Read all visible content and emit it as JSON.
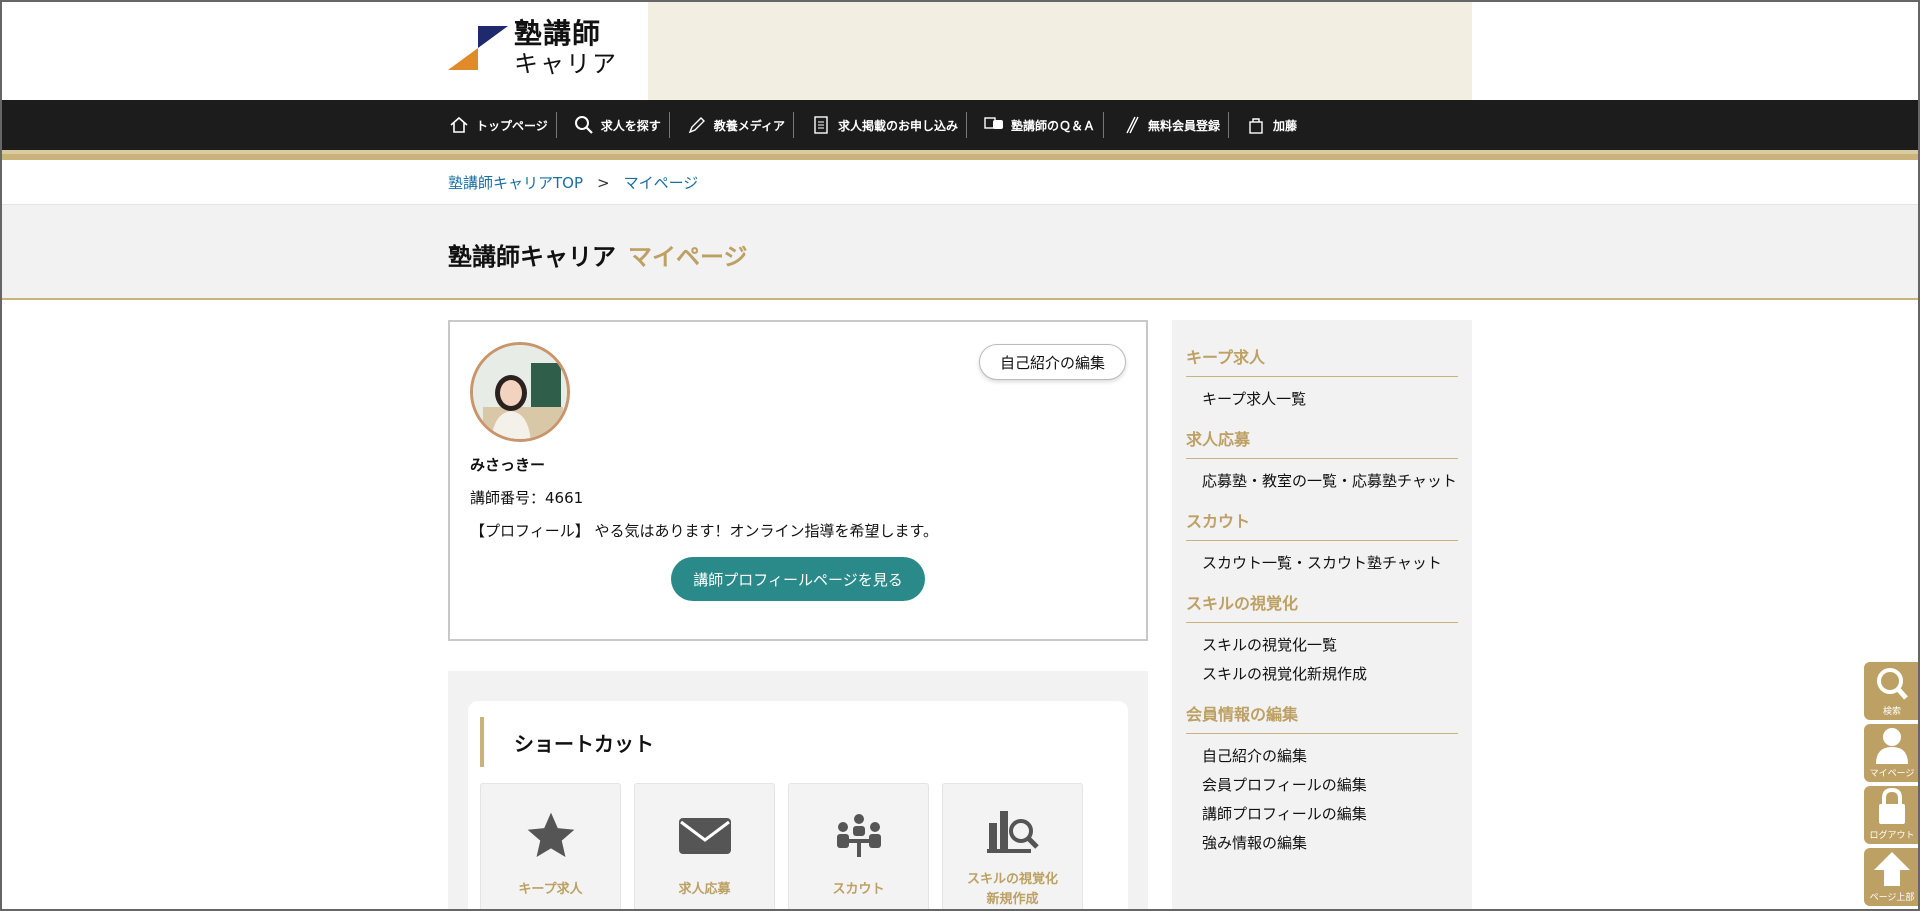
{
  "header": {
    "logo_line1": "塾講師",
    "logo_line2": "キャリア"
  },
  "nav": [
    {
      "label": "トップページ",
      "icon": "home-icon"
    },
    {
      "label": "求人を探す",
      "icon": "search-icon"
    },
    {
      "label": "教養メディア",
      "icon": "pen-icon"
    },
    {
      "label": "求人掲載のお申し込み",
      "icon": "document-icon"
    },
    {
      "label": "塾講師のＱ＆Ａ",
      "icon": "chat-icon"
    },
    {
      "label": "無料会員登録",
      "icon": "pencil-icon"
    },
    {
      "label": "加藤",
      "icon": "bag-icon"
    }
  ],
  "breadcrumb": {
    "home": "塾講師キャリアTOP",
    "sep": ">",
    "current": "マイページ"
  },
  "title": {
    "main": "塾講師キャリア",
    "accent": "マイページ"
  },
  "profile": {
    "edit_button": "自己紹介の編集",
    "name": "みさっきー",
    "id_text": "講師番号：4661",
    "profile_text": "【プロフィール】 やる気はあります！オンライン指導を希望します。",
    "view_button": "講師プロフィールページを見る"
  },
  "shortcut": {
    "heading": "ショートカット",
    "tiles": [
      {
        "label": "キープ求人",
        "icon": "star-icon"
      },
      {
        "label": "求人応募",
        "icon": "mail-icon"
      },
      {
        "label": "スカウト",
        "icon": "meeting-icon"
      },
      {
        "label": "スキルの視覚化\n新規作成",
        "icon": "chart-search-icon"
      }
    ]
  },
  "sidebar": {
    "sections": [
      {
        "heading": "キープ求人",
        "links": [
          "キープ求人一覧"
        ]
      },
      {
        "heading": "求人応募",
        "links": [
          "応募塾・教室の一覧・応募塾チャット"
        ]
      },
      {
        "heading": "スカウト",
        "links": [
          "スカウト一覧・スカウト塾チャット"
        ]
      },
      {
        "heading": "スキルの視覚化",
        "links": [
          "スキルの視覚化一覧",
          "スキルの視覚化新規作成"
        ]
      },
      {
        "heading": "会員情報の編集",
        "links": [
          "自己紹介の編集",
          "会員プロフィールの編集",
          "講師プロフィールの編集",
          "強み情報の編集"
        ]
      }
    ]
  },
  "floating": {
    "search": "検索",
    "mypage": "マイページ",
    "logout": "ログアウト",
    "top": "ページ上部"
  },
  "colors": {
    "accent_gold": "#bda064",
    "nav_bg": "#1c1c1c",
    "teal_button": "#2a8a8a",
    "link_blue": "#1a6fa3"
  }
}
